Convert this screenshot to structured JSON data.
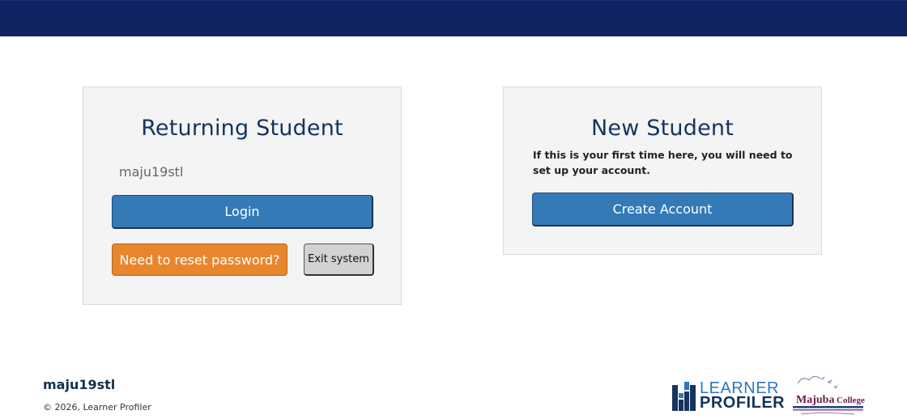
{
  "header": {
    "bar_color": "#0f2262"
  },
  "returning": {
    "title": "Returning Student",
    "username": "maju19stl",
    "login_label": "Login",
    "reset_label": "Need to reset password?",
    "exit_label": "Exit system"
  },
  "new_student": {
    "title": "New Student",
    "info": "If this is your first time here, you will need to set up your account.",
    "create_label": "Create Account"
  },
  "footer": {
    "username": "maju19stl",
    "copyright": "© 2026, Learner Profiler"
  },
  "logos": {
    "learner_profiler": {
      "line1": "LEARNER",
      "line2": "PROFILER"
    },
    "majuba": {
      "name": "Majuba College"
    }
  },
  "colors": {
    "primary": "#337ab7",
    "warning": "#e8862e",
    "title": "#14355f"
  }
}
